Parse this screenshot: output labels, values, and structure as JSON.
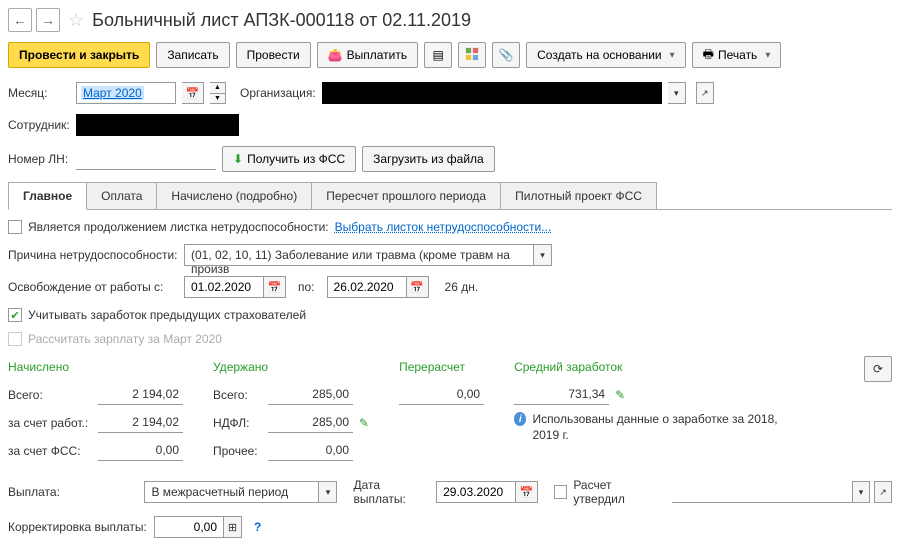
{
  "header": {
    "title": "Больничный лист АПЗК-000118 от 02.11.2019"
  },
  "toolbar": {
    "submit_close": "Провести и закрыть",
    "save": "Записать",
    "submit": "Провести",
    "pay": "Выплатить",
    "create_based": "Создать на основании",
    "print": "Печать"
  },
  "form": {
    "month_label": "Месяц:",
    "month_value": "Март 2020",
    "org_label": "Организация:",
    "employee_label": "Сотрудник:",
    "ln_label": "Номер ЛН:",
    "get_fss": "Получить из ФСС",
    "load_file": "Загрузить из файла"
  },
  "tabs": {
    "main": "Главное",
    "payment": "Оплата",
    "detail": "Начислено (подробно)",
    "recalc": "Пересчет прошлого периода",
    "pilot": "Пилотный проект ФСС"
  },
  "main": {
    "continuation_label": "Является продолжением листка нетрудоспособности:",
    "select_sheet_link": "Выбрать листок нетрудоспособности...",
    "reason_label": "Причина нетрудоспособности:",
    "reason_value": "(01, 02, 10, 11) Заболевание или травма (кроме травм на произв",
    "release_from_label": "Освобождение от работы с:",
    "date_from": "01.02.2020",
    "to_label": "по:",
    "date_to": "26.02.2020",
    "days_count": "26 дн.",
    "prev_earnings_label": "Учитывать заработок предыдущих страхователей",
    "recalc_salary_label": "Рассчитать зарплату за Март 2020"
  },
  "calc": {
    "accrued": "Начислено",
    "withheld": "Удержано",
    "recalc": "Перерасчет",
    "avg_earnings": "Средний заработок",
    "total_label": "Всего:",
    "employer_label": "за счет работ.:",
    "fss_label": "за счет ФСС:",
    "ndfl_label": "НДФЛ:",
    "other_label": "Прочее:",
    "total_val": "2 194,02",
    "employer_val": "2 194,02",
    "fss_val": "0,00",
    "withheld_total": "285,00",
    "ndfl_val": "285,00",
    "other_val": "0,00",
    "recalc_val": "0,00",
    "avg_val": "731,34",
    "info_text": "Использованы данные о заработке за 2018,  2019 г."
  },
  "bottom": {
    "payout_label": "Выплата:",
    "payout_mode": "В межрасчетный период",
    "payout_date_label": "Дата выплаты:",
    "payout_date": "29.03.2020",
    "approved_label": "Расчет утвердил",
    "correction_label": "Корректировка выплаты:",
    "correction_val": "0,00"
  }
}
